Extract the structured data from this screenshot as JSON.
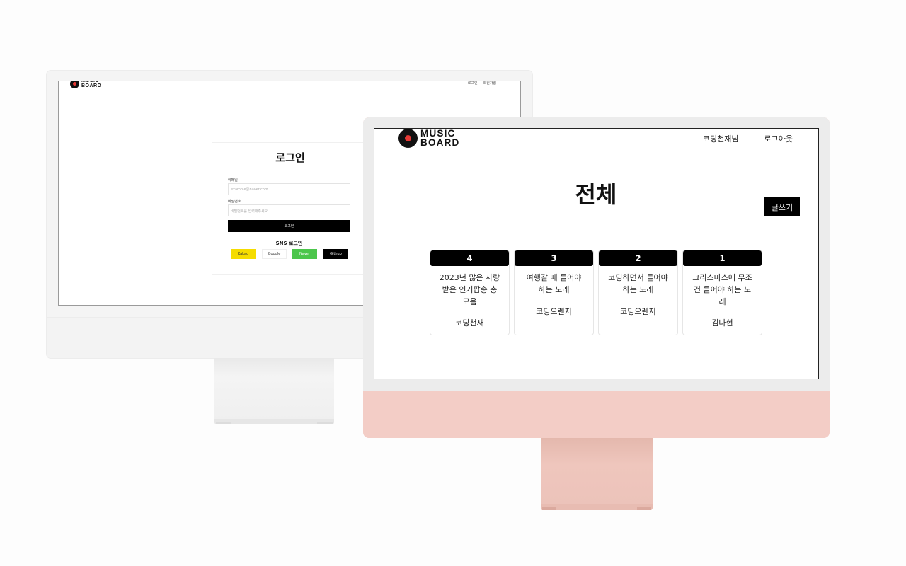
{
  "back_screen": {
    "logo": {
      "text": "MUSIC\nBOARD",
      "icon": "vinyl-record-icon"
    },
    "nav": {
      "login": "로그인",
      "signup": "회원가입"
    },
    "login_form": {
      "title": "로그인",
      "email_label": "이메일",
      "email_placeholder": "example@naver.com",
      "password_label": "비밀번호",
      "password_placeholder": "비밀번호를 입력해주세요.",
      "submit_label": "로그인",
      "sns_title": "SNS 로그인",
      "sns_buttons": {
        "kakao": "Kakao",
        "google": "Google",
        "naver": "Naver",
        "github": "Github"
      }
    }
  },
  "front_screen": {
    "logo": {
      "text": "MUSIC\nBOARD",
      "icon": "vinyl-record-icon"
    },
    "nav": {
      "user": "코딩천재님",
      "logout": "로그아웃"
    },
    "page_title": "전체",
    "write_button": "글쓰기",
    "posts": [
      {
        "number": "4",
        "title": "2023년 많은 사랑 받은 인기팝송 총 모음",
        "author": "코딩천재"
      },
      {
        "number": "3",
        "title": "여행갈 때 들어야 하는 노래",
        "author": "코딩오렌지"
      },
      {
        "number": "2",
        "title": "코딩하면서 들어야 하는 노래",
        "author": "코딩오렌지"
      },
      {
        "number": "1",
        "title": "크리스마스에 무조건 들어야 하는 노래",
        "author": "김나현"
      }
    ]
  },
  "colors": {
    "front_monitor_body": "#f3cdc6",
    "back_monitor_body": "#f4f4f4",
    "kakao": "#f5dc00",
    "naver": "#4cc64c",
    "accent": "#000000"
  }
}
